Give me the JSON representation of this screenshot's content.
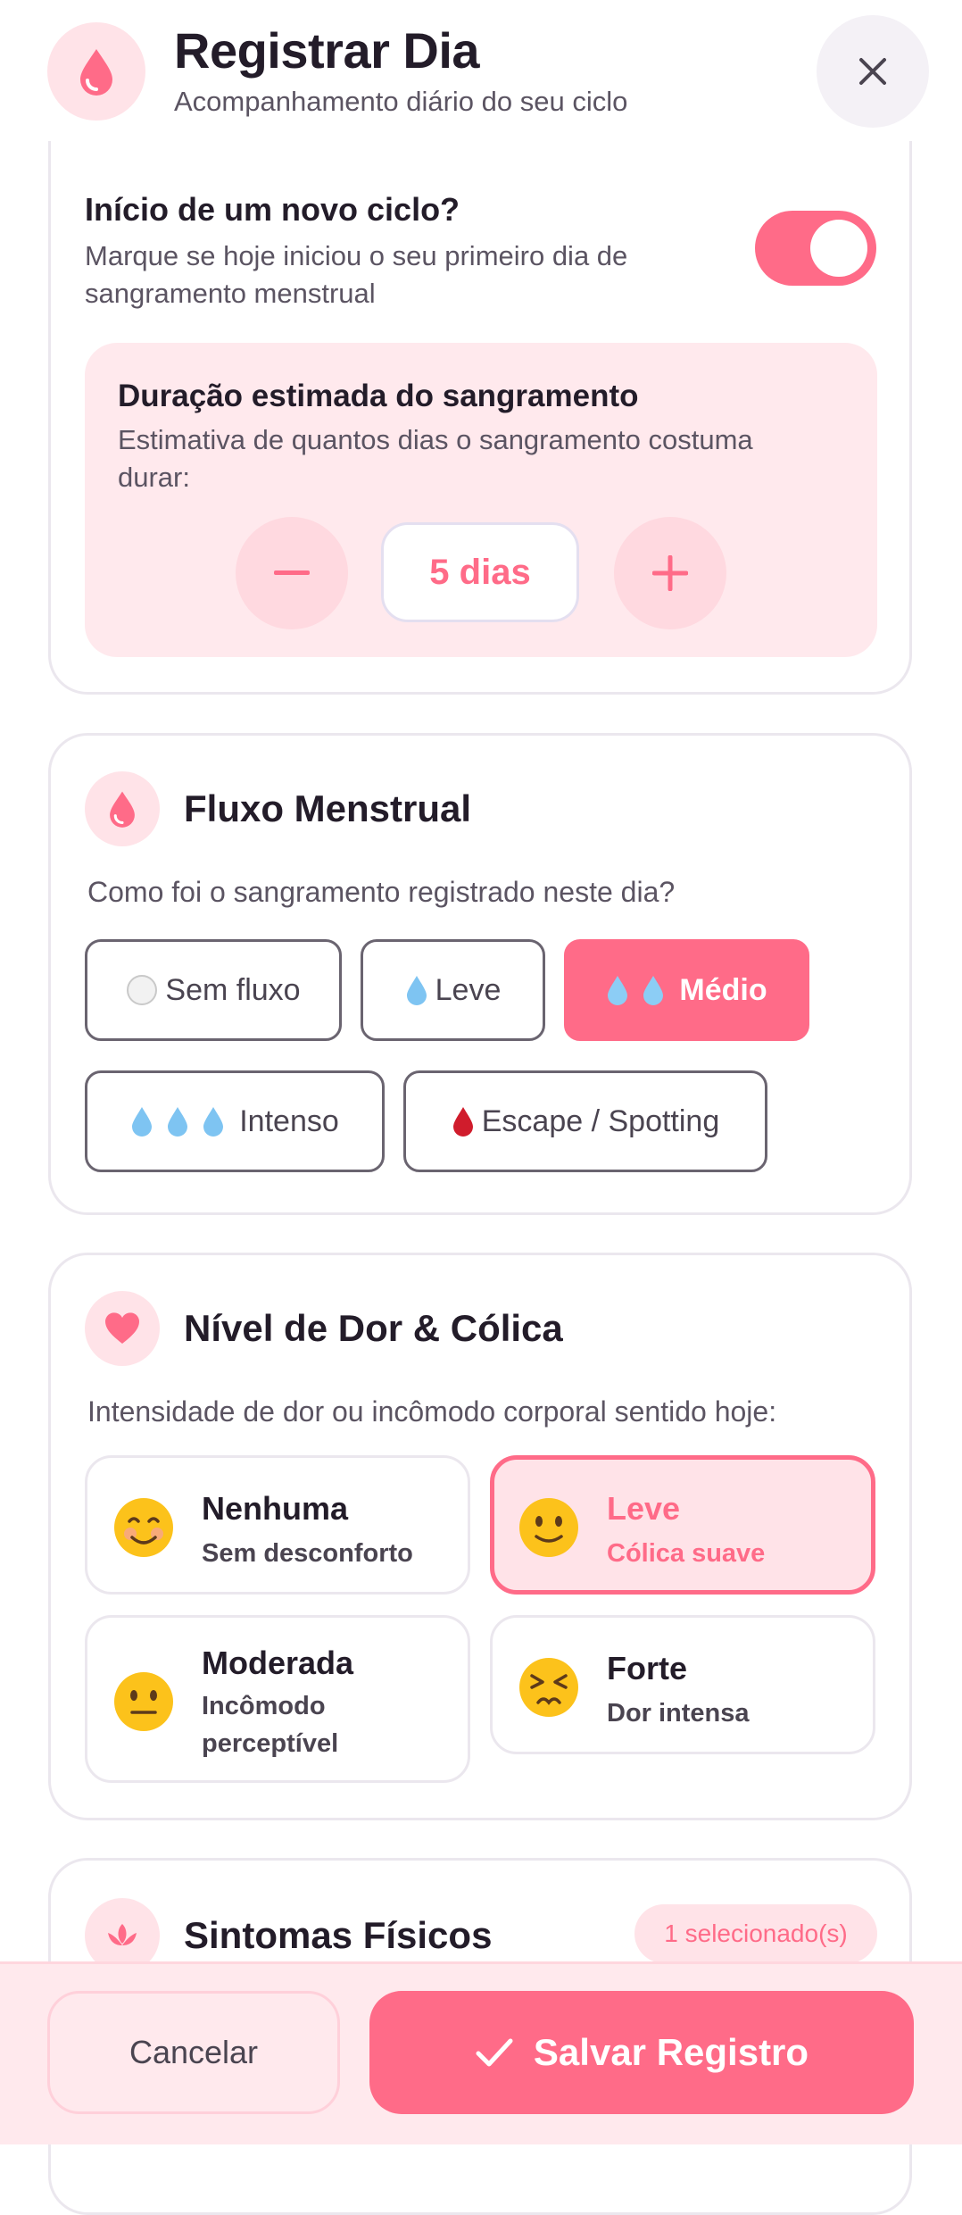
{
  "header": {
    "title": "Registrar Dia",
    "subtitle": "Acompanhamento diário do seu ciclo"
  },
  "new_cycle": {
    "title": "Início de um novo ciclo?",
    "description_line1": "Marque se hoje iniciou o seu primeiro dia de",
    "description_line2": "sangramento menstrual",
    "toggle_on": true
  },
  "duration": {
    "title": "Duração estimada do sangramento",
    "description_line1": "Estimativa de quantos dias o sangramento costuma",
    "description_line2": "durar:",
    "value": "5 dias"
  },
  "flow": {
    "title": "Fluxo Menstrual",
    "question": "Como foi o sangramento registrado neste dia?",
    "options": [
      {
        "label": "Sem fluxo",
        "icon": "white-circle-icon"
      },
      {
        "label": "Leve",
        "icon": "droplet-icon"
      },
      {
        "label": "Médio",
        "icon": "two-droplets-icon",
        "selected": true
      },
      {
        "label": "Intenso",
        "icon": "three-droplets-icon"
      },
      {
        "label": "Escape / Spotting",
        "icon": "blood-drop-icon"
      }
    ]
  },
  "pain": {
    "title": "Nível de Dor & Cólica",
    "question": "Intensidade de dor ou incômodo corporal sentido hoje:",
    "options": [
      {
        "title": "Nenhuma",
        "subtitle": "Sem desconforto",
        "icon": "smiling-face-icon"
      },
      {
        "title": "Leve",
        "subtitle": "Cólica suave",
        "icon": "slight-smile-icon",
        "selected": true
      },
      {
        "title": "Moderada",
        "subtitle_line1": "Incômodo",
        "subtitle_line2": "perceptível",
        "icon": "neutral-face-icon"
      },
      {
        "title": "Forte",
        "subtitle": "Dor intensa",
        "icon": "persevering-face-icon"
      }
    ]
  },
  "symptoms": {
    "title": "Sintomas Físicos",
    "badge": "1 selecionado(s)"
  },
  "footer": {
    "cancel_label": "Cancelar",
    "save_label": "Salvar Registro"
  },
  "colors": {
    "accent": "#ff6b88",
    "accent_light": "#ffe3e8"
  }
}
